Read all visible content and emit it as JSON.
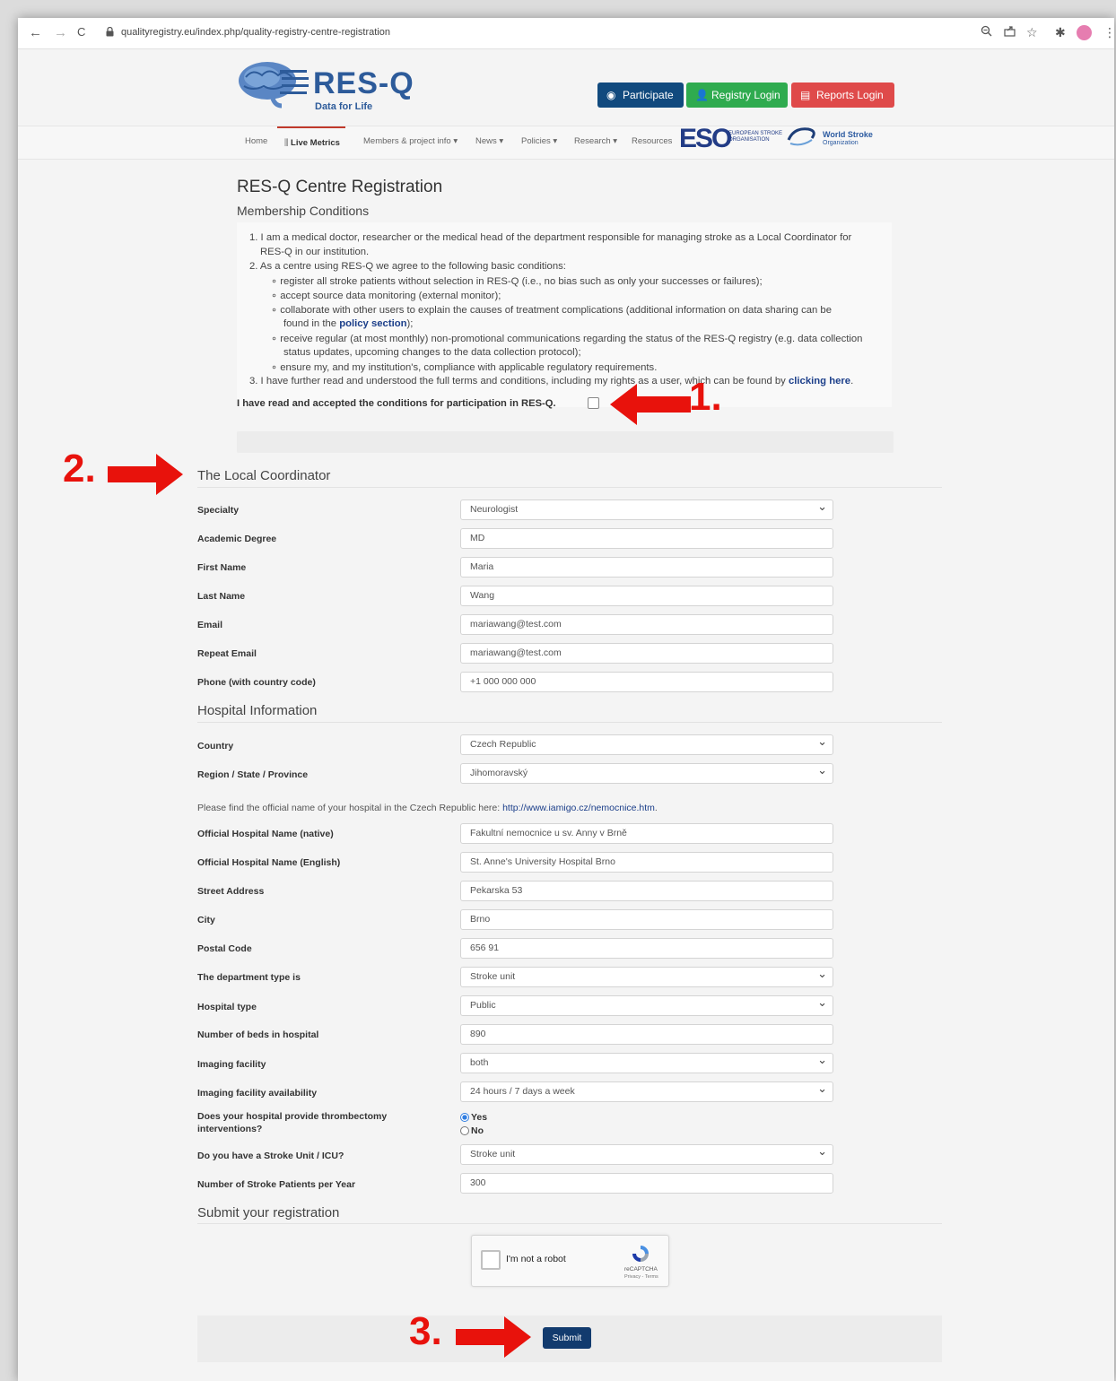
{
  "browser": {
    "back": "←",
    "forward": "→",
    "reload": "C",
    "url": "qualityregistry.eu/index.php/quality-registry-centre-registration",
    "icons": [
      "zoom-icon",
      "share-icon",
      "star-icon",
      "extension-icon",
      "profile-avatar",
      "menu-icon"
    ]
  },
  "header": {
    "logo_brand": "RES-Q",
    "logo_tagline": "Data for Life",
    "buttons": {
      "participate": "Participate",
      "registry_login": "Registry Login",
      "reports_login": "Reports Login"
    },
    "colors": {
      "participate": "#114a7e",
      "registry_login": "#2fab4f",
      "reports_login": "#df4a4a"
    }
  },
  "nav": {
    "home": "Home",
    "live_metrics": "Live Metrics",
    "members": "Members & project info ▾",
    "news": "News ▾",
    "policies": "Policies ▾",
    "research": "Research ▾",
    "resources": "Resources"
  },
  "partners": {
    "eso_mark": "ESO",
    "eso_text": "EUROPEAN STROKE ORGANISATION",
    "wso_name": "World Stroke",
    "wso_sub": "Organization"
  },
  "page": {
    "title": "RES-Q Centre Registration",
    "subtitle": "Membership Conditions"
  },
  "conditions": {
    "c1a": "1. I am a medical doctor, researcher or the medical head of the department responsible for managing stroke as a Local Coordinator for",
    "c1b": "RES-Q in our institution.",
    "c2": "2. As a centre using RES-Q we agree to the following basic conditions:",
    "b1": "∘  register all stroke patients without selection in RES-Q (i.e., no bias such as only your successes or failures);",
    "b2": "∘  accept source data monitoring (external monitor);",
    "b3": "∘  collaborate with other users to explain the causes of treatment complications (additional information on data sharing can be",
    "b3b_pre": "found in the ",
    "b3b_link": "policy section",
    "b3b_post": ");",
    "b4": "∘  receive regular (at most monthly) non-promotional communications regarding the status of the RES-Q registry (e.g. data collection",
    "b4b": "status updates, upcoming changes to the data collection protocol);",
    "b5": "∘  ensure my, and my institution's, compliance with applicable regulatory requirements.",
    "c3_pre": "3. I have further read and understood the full terms and conditions, including my rights as a user, which can be found by ",
    "c3_link": "clicking here",
    "c3_post": ".",
    "accept": "I have read and accepted the conditions for participation in RES-Q."
  },
  "coordinator": {
    "section": "The Local Coordinator",
    "specialty": {
      "label": "Specialty",
      "value": "Neurologist"
    },
    "degree": {
      "label": "Academic Degree",
      "value": "MD"
    },
    "first": {
      "label": "First Name",
      "value": "Maria"
    },
    "last": {
      "label": "Last Name",
      "value": "Wang"
    },
    "email": {
      "label": "Email",
      "value": "mariawang@test.com"
    },
    "email2": {
      "label": "Repeat Email",
      "value": "mariawang@test.com"
    },
    "phone": {
      "label": "Phone (with country code)",
      "value": "+1 000 000 000"
    }
  },
  "hospital": {
    "section": "Hospital Information",
    "country": {
      "label": "Country",
      "value": "Czech Republic"
    },
    "region": {
      "label": "Region / State / Province",
      "value": "Jihomoravský"
    },
    "hint_pre": "Please find the official name of your hospital in the Czech Republic here: ",
    "hint_link": "http://www.iamigo.cz/nemocnice.htm",
    "hint_post": ".",
    "name_native": {
      "label": "Official Hospital Name (native)",
      "value": "Fakultní nemocnice u sv. Anny v Brně"
    },
    "name_en": {
      "label": "Official Hospital Name (English)",
      "value": "St. Anne's University Hospital Brno"
    },
    "street": {
      "label": "Street Address",
      "value": "Pekarska 53"
    },
    "city": {
      "label": "City",
      "value": "Brno"
    },
    "postal": {
      "label": "Postal Code",
      "value": "656 91"
    },
    "dept": {
      "label": "The department type is",
      "value": "Stroke unit"
    },
    "htype": {
      "label": "Hospital type",
      "value": "Public"
    },
    "beds": {
      "label": "Number of beds in hospital",
      "value": "890"
    },
    "imaging": {
      "label": "Imaging facility",
      "value": "both"
    },
    "imaging_avail": {
      "label": "Imaging facility availability",
      "value": "24 hours / 7 days a week"
    },
    "thrombectomy": {
      "label1": "Does your hospital provide thrombectomy",
      "label2": "interventions?",
      "yes": "Yes",
      "no": "No",
      "selected": "Yes"
    },
    "stroke_unit": {
      "label": "Do you have a Stroke Unit / ICU?",
      "value": "Stroke unit"
    },
    "patients": {
      "label": "Number of Stroke Patients per Year",
      "value": "300"
    }
  },
  "submit_section": {
    "section": "Submit your registration",
    "captcha_text": "I'm not a robot",
    "captcha_brand": "reCAPTCHA",
    "captcha_terms": "Privacy - Terms",
    "submit": "Submit"
  },
  "annotations": {
    "a1": "1.",
    "a2": "2.",
    "a3": "3.",
    "color": "#e8120c"
  }
}
